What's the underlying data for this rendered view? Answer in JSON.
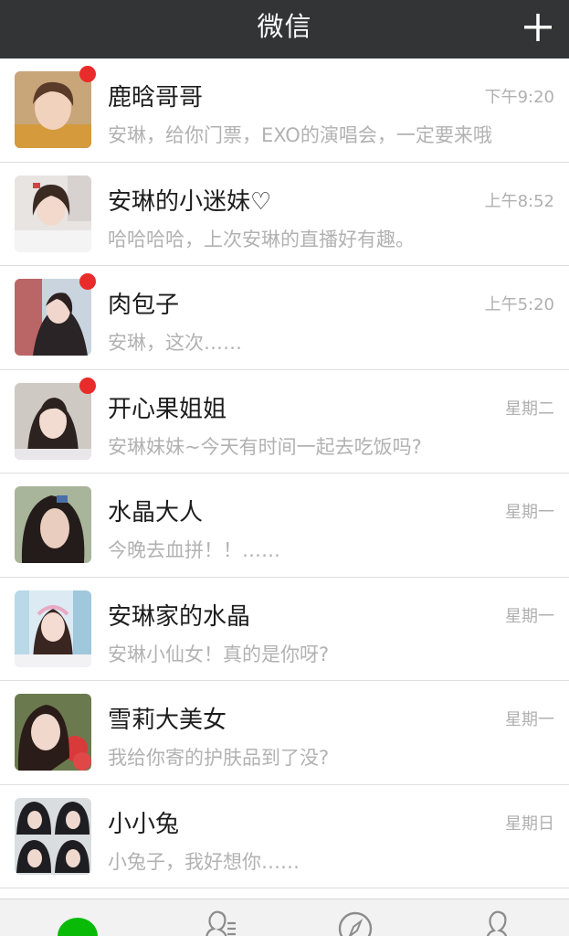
{
  "header": {
    "title": "微信",
    "add_icon": "plus-icon"
  },
  "chats": [
    {
      "name": "鹿晗哥哥",
      "time": "下午9:20",
      "message": "安琳，给你门票，EXO的演唱会，一定要来哦",
      "unread": true
    },
    {
      "name": "安琳的小迷妹♡",
      "time": "上午8:52",
      "message": "哈哈哈哈，上次安琳的直播好有趣。",
      "unread": false
    },
    {
      "name": "肉包子",
      "time": "上午5:20",
      "message": "安琳，这次……",
      "unread": true
    },
    {
      "name": "开心果姐姐",
      "time": "星期二",
      "message": "安琳妹妹~今天有时间一起去吃饭吗?",
      "unread": true
    },
    {
      "name": "水晶大人",
      "time": "星期一",
      "message": "今晚去血拼！！……",
      "unread": false
    },
    {
      "name": "安琳家的水晶",
      "time": "星期一",
      "message": "安琳小仙女！真的是你呀?",
      "unread": false
    },
    {
      "name": "雪莉大美女",
      "time": "星期一",
      "message": "我给你寄的护肤品到了没?",
      "unread": false
    },
    {
      "name": "小小兔",
      "time": "星期日",
      "message": "小兔子，我好想你……",
      "unread": false
    }
  ],
  "tabbar": {
    "tabs": [
      "chats-tab-icon",
      "contacts-icon",
      "discover-compass-icon",
      "me-person-icon"
    ],
    "active_color": "#09bb07"
  },
  "colors": {
    "header_bg": "#333436",
    "unread_dot": "#e92b2b"
  }
}
